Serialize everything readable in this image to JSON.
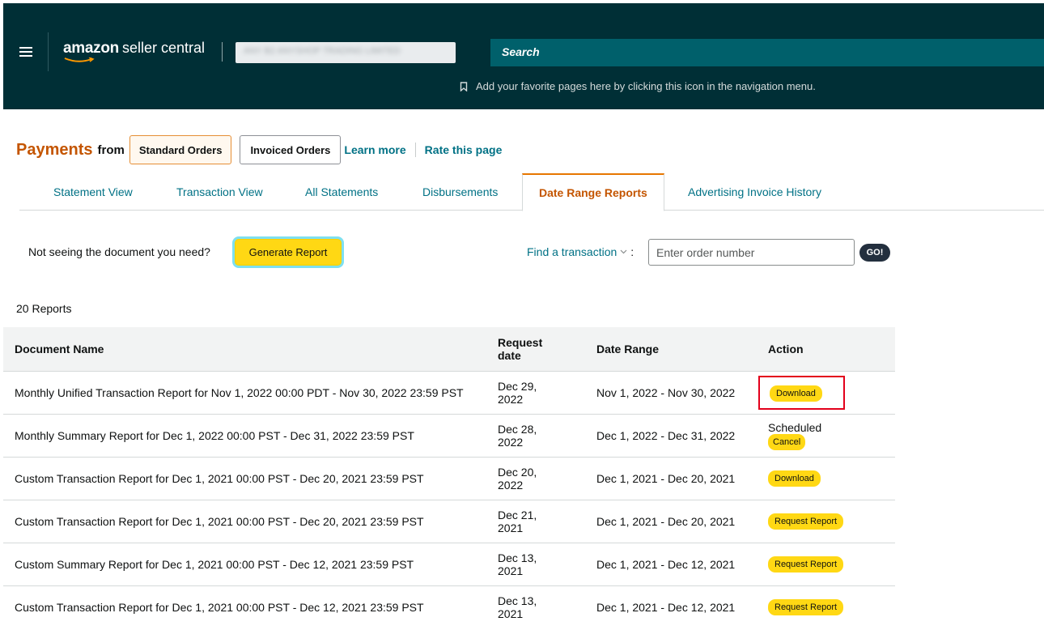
{
  "header": {
    "brand": "amazon",
    "product": "seller central",
    "account_name": "ANY B2 ANYSHOP TRADING LIMITED",
    "search_placeholder": "Search",
    "favorites_hint": "Add your favorite pages here by clicking this icon in the navigation menu."
  },
  "payments": {
    "title": "Payments",
    "from": "from",
    "standard_orders": "Standard Orders",
    "invoiced_orders": "Invoiced Orders",
    "learn_more": "Learn more",
    "rate_page": "Rate this page"
  },
  "tabs": [
    {
      "label": "Statement View"
    },
    {
      "label": "Transaction View"
    },
    {
      "label": "All Statements"
    },
    {
      "label": "Disbursements"
    },
    {
      "label": "Date Range Reports",
      "active": true
    },
    {
      "label": "Advertising Invoice History"
    }
  ],
  "toolbar": {
    "not_seeing": "Not seeing the document you need?",
    "generate_report": "Generate Report",
    "find_transaction": "Find a transaction",
    "find_suffix": ":",
    "order_placeholder": "Enter order number",
    "go": "GO!"
  },
  "reports": {
    "count_label": "20 Reports",
    "columns": {
      "name": "Document Name",
      "request_date": "Request date",
      "date_range": "Date Range",
      "action": "Action"
    },
    "rows": [
      {
        "name": "Monthly Unified Transaction Report for Nov 1, 2022 00:00 PDT - Nov 30, 2022 23:59 PST",
        "request_date": "Dec 29, 2022",
        "date_range": "Nov 1, 2022 - Nov 30, 2022",
        "action": "Download"
      },
      {
        "name": "Monthly Summary Report for Dec 1, 2022 00:00 PST - Dec 31, 2022 23:59 PST",
        "request_date": "Dec 28, 2022",
        "date_range": "Dec 1, 2022 - Dec 31, 2022",
        "status": "Scheduled",
        "action": "Cancel"
      },
      {
        "name": "Custom Transaction Report for Dec 1, 2021 00:00 PST - Dec 20, 2021 23:59 PST",
        "request_date": "Dec 20, 2022",
        "date_range": "Dec 1, 2021 - Dec 20, 2021",
        "action": "Download"
      },
      {
        "name": "Custom Transaction Report for Dec 1, 2021 00:00 PST - Dec 20, 2021 23:59 PST",
        "request_date": "Dec 21, 2021",
        "date_range": "Dec 1, 2021 - Dec 20, 2021",
        "action": "Request Report"
      },
      {
        "name": "Custom Summary Report for Dec 1, 2021 00:00 PST - Dec 12, 2021 23:59 PST",
        "request_date": "Dec 13, 2021",
        "date_range": "Dec 1, 2021 - Dec 12, 2021",
        "action": "Request Report"
      },
      {
        "name": "Custom Transaction Report for Dec 1, 2021 00:00 PST - Dec 12, 2021 23:59 PST",
        "request_date": "Dec 13, 2021",
        "date_range": "Dec 1, 2021 - Dec 12, 2021",
        "action": "Request Report"
      }
    ]
  },
  "colors": {
    "header_bg": "#002f36",
    "search_bg": "#00606b",
    "accent_orange": "#c45500",
    "link_teal": "#007185",
    "button_yellow": "#ffd814",
    "highlight_red": "#e3001b"
  }
}
